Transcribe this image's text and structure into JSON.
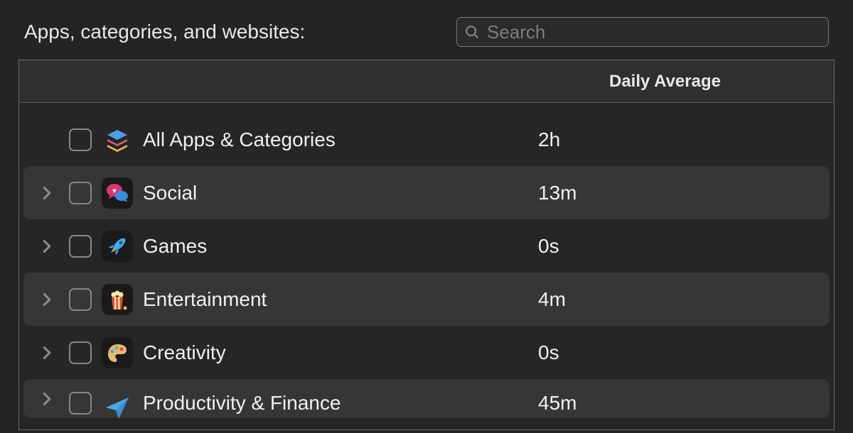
{
  "header": {
    "label": "Apps, categories, and websites:",
    "search_placeholder": "Search"
  },
  "table": {
    "avg_header": "Daily Average",
    "rows": [
      {
        "name": "All Apps & Categories",
        "avg": "2h",
        "icon": "stack-icon",
        "expandable": false
      },
      {
        "name": "Social",
        "avg": "13m",
        "icon": "social-icon",
        "expandable": true
      },
      {
        "name": "Games",
        "avg": "0s",
        "icon": "rocket-icon",
        "expandable": true
      },
      {
        "name": "Entertainment",
        "avg": "4m",
        "icon": "popcorn-icon",
        "expandable": true
      },
      {
        "name": "Creativity",
        "avg": "0s",
        "icon": "palette-icon",
        "expandable": true
      },
      {
        "name": "Productivity & Finance",
        "avg": "45m",
        "icon": "send-icon",
        "expandable": true
      }
    ]
  }
}
